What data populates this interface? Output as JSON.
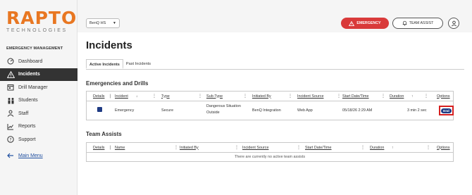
{
  "logo": {
    "main": "RAPTOR",
    "sub": "TECHNOLOGIES"
  },
  "sidebar": {
    "heading": "EMERGENCY MANAGEMENT",
    "items": [
      {
        "label": "Dashboard",
        "icon": "dashboard-icon"
      },
      {
        "label": "Incidents",
        "icon": "warning-icon",
        "active": true
      },
      {
        "label": "Drill Manager",
        "icon": "calendar-icon"
      },
      {
        "label": "Students",
        "icon": "students-icon"
      },
      {
        "label": "Staff",
        "icon": "staff-icon"
      },
      {
        "label": "Reports",
        "icon": "chart-icon"
      },
      {
        "label": "Support",
        "icon": "help-icon"
      }
    ],
    "back": "Main Menu"
  },
  "header": {
    "school": "BenQ HS",
    "emergency_label": "EMERGENCY",
    "team_assist_label": "TEAM ASSIST"
  },
  "page": {
    "title": "Incidents",
    "tabs": [
      "Active Incidents",
      "Past Incidents"
    ]
  },
  "emergencies": {
    "title": "Emergencies and Drills",
    "columns": [
      "Details",
      "Incident",
      "Type",
      "Sub-Type",
      "Initiated By",
      "Incident Source",
      "Start Date/Time",
      "Duration",
      "Options"
    ],
    "row": {
      "incident": "Emergency",
      "type": "Secure",
      "subtype_line1": "Dangerous Situation",
      "subtype_line2": "Outside",
      "initiated_by": "BenQ Integration",
      "source": "Web App",
      "start": "05/18/26 2:29 AM",
      "duration": "3 min 2 sec",
      "option_label": "End"
    }
  },
  "team_assists": {
    "title": "Team Assists",
    "columns": [
      "Details",
      "Name",
      "Initiated By",
      "Incident Source",
      "Start Date/Time",
      "Duration",
      "Options"
    ],
    "empty": "There are currently no active team assists"
  },
  "colors": {
    "accent": "#e87722",
    "emergency": "#d93a3a",
    "nav_active": "#333333",
    "end_button": "#1f3b84"
  }
}
